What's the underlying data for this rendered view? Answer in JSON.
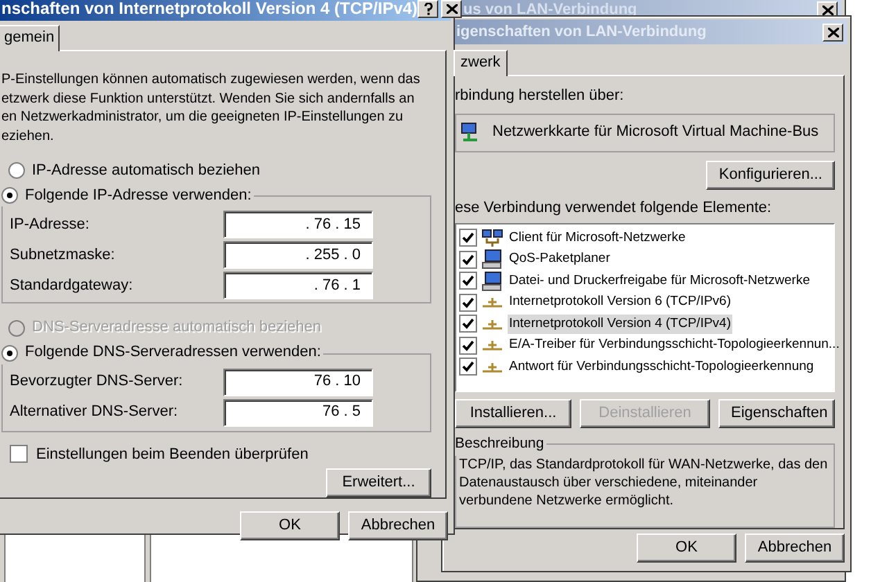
{
  "back_window": {
    "title": "us von LAN-Verbindung"
  },
  "ipv4_dialog": {
    "title": "nschaften von Internetprotokoll Version 4 (TCP/IPv4)",
    "tabs": [
      {
        "label": "gemein",
        "selected": true
      }
    ],
    "intro": "P-Einstellungen können automatisch zugewiesen werden, wenn das\netzwerk diese Funktion unterstützt. Wenden Sie sich andernfalls an\nen Netzwerkadministrator, um die geeigneten IP-Einstellungen zu\neziehen.",
    "ip_modes": [
      {
        "label": "IP-Adresse automatisch beziehen",
        "selected": false,
        "disabled": false
      },
      {
        "label": "Folgende IP-Adresse verwenden:",
        "selected": true,
        "disabled": false
      }
    ],
    "ip_fields": [
      {
        "label": "IP-Adresse:",
        "value": ". 76 . 15"
      },
      {
        "label": "Subnetzmaske:",
        "value": ". 255 . 0"
      },
      {
        "label": "Standardgateway:",
        "value": ". 76 . 1"
      }
    ],
    "dns_modes": [
      {
        "label": "DNS-Serveradresse automatisch beziehen",
        "selected": false,
        "disabled": true
      },
      {
        "label": "Folgende DNS-Serveradressen verwenden:",
        "selected": true,
        "disabled": false
      }
    ],
    "dns_fields": [
      {
        "label": "Bevorzugter DNS-Server:",
        "value": "76 . 10"
      },
      {
        "label": "Alternativer DNS-Server:",
        "value": "76 . 5"
      }
    ],
    "validate": {
      "label": "Einstellungen beim Beenden überprüfen",
      "checked": false
    },
    "advanced_button": "Erweitert...",
    "buttons": [
      "OK",
      "Abbrechen"
    ]
  },
  "lan_dialog": {
    "title": "igenschaften von LAN-Verbindung",
    "tabs": [
      {
        "label": "zwerk",
        "selected": true
      }
    ],
    "connect_label": "rbindung herstellen über:",
    "adapter": "Netzwerkkarte für Microsoft Virtual Machine-Bus",
    "configure_button": "Konfigurieren...",
    "items_label": "ese Verbindung verwendet folgende Elemente:",
    "items": [
      {
        "label": "Client für Microsoft-Netzwerke",
        "kind": "client",
        "checked": true,
        "selected": false
      },
      {
        "label": "QoS-Paketplaner",
        "kind": "service",
        "checked": true,
        "selected": false
      },
      {
        "label": "Datei- und Druckerfreigabe für Microsoft-Netzwerke",
        "kind": "service",
        "checked": true,
        "selected": false
      },
      {
        "label": "Internetprotokoll Version 6 (TCP/IPv6)",
        "kind": "protocol",
        "checked": true,
        "selected": false
      },
      {
        "label": "Internetprotokoll Version 4 (TCP/IPv4)",
        "kind": "protocol",
        "checked": true,
        "selected": true
      },
      {
        "label": "E/A-Treiber für Verbindungsschicht-Topologieerkennun...",
        "kind": "protocol",
        "checked": true,
        "selected": false
      },
      {
        "label": "Antwort für Verbindungsschicht-Topologieerkennung",
        "kind": "protocol",
        "checked": true,
        "selected": false
      }
    ],
    "item_buttons": [
      {
        "label": "Installieren...",
        "disabled": false
      },
      {
        "label": "Deinstallieren",
        "disabled": true
      },
      {
        "label": "Eigenschaften",
        "disabled": false
      }
    ],
    "description_title": "Beschreibung",
    "description": "TCP/IP, das Standardprotokoll für WAN-Netzwerke, das den Datenaustausch über verschiedene, miteinander verbundene Netzwerke ermöglicht.",
    "buttons": [
      "OK",
      "Abbrechen"
    ]
  }
}
